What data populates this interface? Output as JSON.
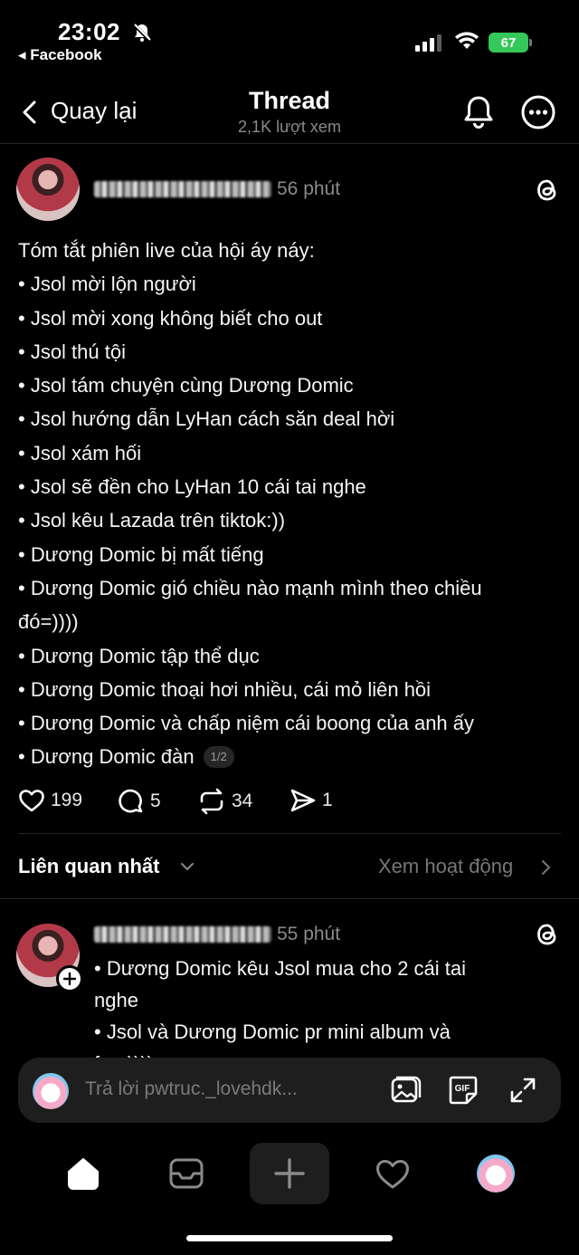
{
  "status_bar": {
    "time": "23:02",
    "back_app": "◂ Facebook",
    "battery": "67"
  },
  "header": {
    "back_label": "Quay lại",
    "title": "Thread",
    "views": "2,1K lượt xem"
  },
  "post": {
    "time_ago": "56 phút",
    "lines": [
      "Tóm tắt phiên live của hội áy náy:",
      "• Jsol mời lộn người",
      "• Jsol mời xong không biết cho out",
      "• Jsol thú tội",
      "• Jsol tám chuyện cùng Dương Domic",
      "• Jsol hướng dẫn LyHan cách săn deal hời",
      "• Jsol xám hối",
      "• Jsol sẽ đền cho LyHan 10 cái tai nghe",
      "• Jsol kêu Lazada trên tiktok:))",
      "• Dương Domic bị mất tiếng",
      "• Dương Domic gió chiều nào mạnh mình theo chiều",
      "đó=))))",
      "• Dương Domic tập thể dục",
      "• Dương Domic thoại hơi nhiều, cái mỏ liên hồi",
      "• Dương Domic và chấp niệm cái boong của anh ấy",
      "• Dương Domic đàn"
    ],
    "page_indicator": "1/2",
    "likes": "199",
    "comments": "5",
    "reposts": "34",
    "shares": "1"
  },
  "sort": {
    "label": "Liên quan nhất",
    "activity_link": "Xem hoạt động"
  },
  "reply": {
    "time_ago": "55 phút",
    "lines": [
      "• Dương Domic kêu Jsol mua cho 2 cái tai",
      "nghe",
      "• Jsol và Dương Domic pr mini album và",
      "fan:))))"
    ]
  },
  "composer": {
    "placeholder": "Trả lời pwtruc._lovehdk..."
  },
  "colors": {
    "background": "#000000",
    "text": "#f3f5f7",
    "secondary": "#8a8a8a",
    "battery": "#34c759"
  }
}
